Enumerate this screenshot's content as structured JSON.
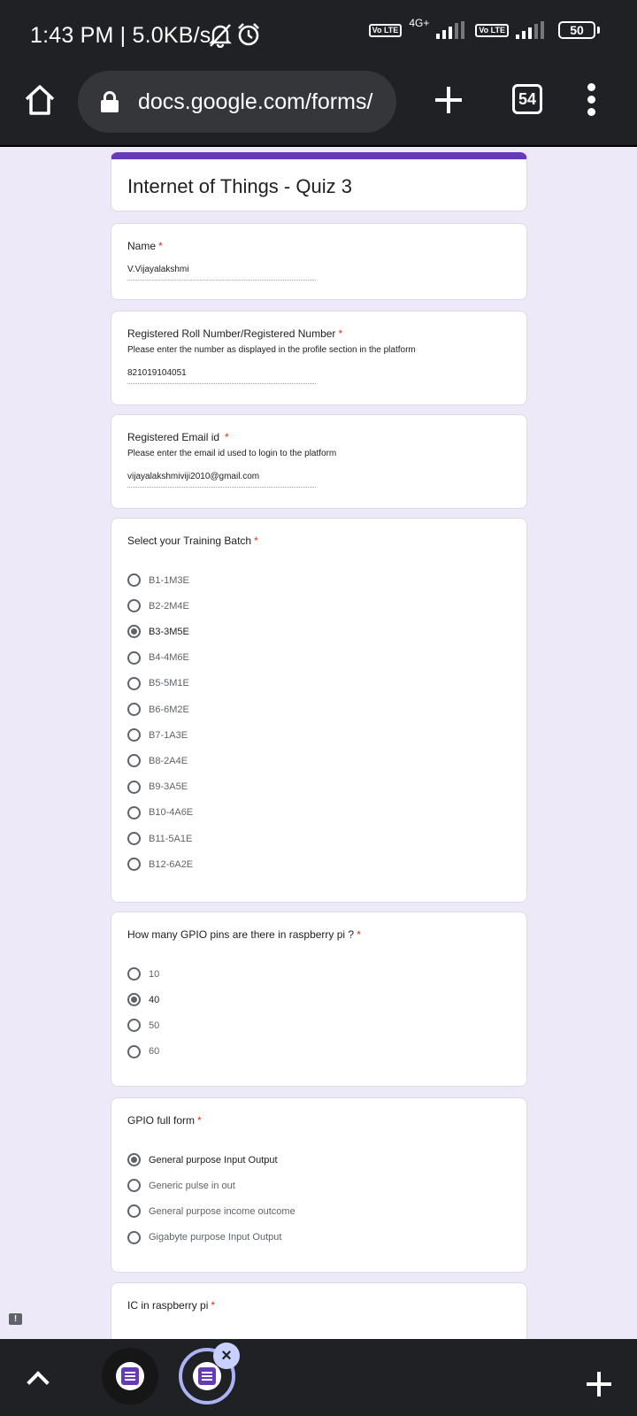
{
  "status_bar": {
    "time": "1:43 PM | 5.0KB/s",
    "sim1_label": "Vo LTE",
    "network_type": "4G+",
    "sim2_label": "Vo LTE",
    "battery": "50",
    "icons": [
      "bell-off-icon",
      "alarm-icon"
    ]
  },
  "browser": {
    "url": "docs.google.com/forms/",
    "tab_count": "54"
  },
  "form": {
    "title": "Internet of Things - Quiz 3",
    "accent_color": "#673ab7",
    "name": {
      "label": "Name",
      "required": "*",
      "value": "V.Vijayalakshmi"
    },
    "roll": {
      "label": "Registered Roll Number/Registered Number",
      "required": "*",
      "description": "Please enter the number as displayed in the profile section in the platform",
      "value": "821019104051"
    },
    "email": {
      "label": "Registered Email id",
      "required": "*",
      "description": "Please enter the email id used to login to the platform",
      "value": "vijayalakshmiviji2010@gmail.com"
    },
    "batch": {
      "label": "Select your Training Batch",
      "required": "*",
      "selected": "B3-3M5E",
      "options": [
        "B1-1M3E",
        "B2-2M4E",
        "B3-3M5E",
        "B4-4M6E",
        "B5-5M1E",
        "B6-6M2E",
        "B7-1A3E",
        "B8-2A4E",
        "B9-3A5E",
        "B10-4A6E",
        "B11-5A1E",
        "B12-6A2E"
      ]
    },
    "gpio_pins": {
      "label": "How many GPIO pins are there in raspberry pi ?",
      "required": "*",
      "selected": "40",
      "options": [
        "10",
        "40",
        "50",
        "60"
      ]
    },
    "gpio_full_form": {
      "label": "GPIO full form",
      "required": "*",
      "selected": "General purpose Input Output",
      "options": [
        "General purpose Input Output",
        "Generic pulse in out",
        "General purpose income outcome",
        "Gigabyte purpose Input Output"
      ]
    },
    "ic": {
      "label": "IC in raspberry pi",
      "required": "*"
    }
  },
  "feedback_badge": "!",
  "bottom_bar": {
    "close_label": "×"
  }
}
